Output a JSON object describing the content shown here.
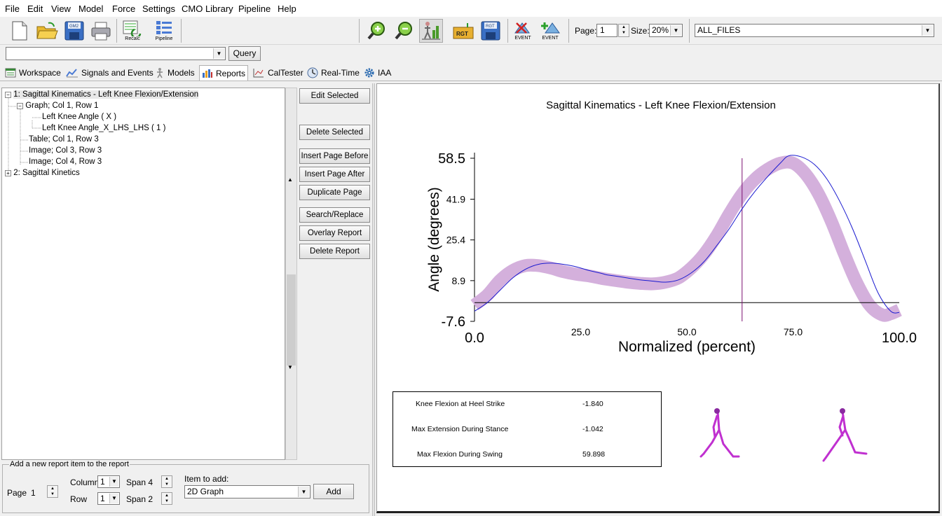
{
  "menu": [
    "File",
    "Edit",
    "View",
    "Model",
    "Force",
    "Settings",
    "CMO Library",
    "Pipeline",
    "Help"
  ],
  "toolbar": {
    "recalc_label": "Recalc",
    "pipeline_label": "Pipeline",
    "gm2_label": "GM2",
    "rgt_label": "RGT",
    "event_label_1": "EVENT",
    "event_label_2": "EVENT",
    "page_label": "Page:",
    "page_value": "1",
    "size_label": "Size:",
    "size_value": "20%",
    "files_value": "ALL_FILES"
  },
  "query": {
    "value": "",
    "button_label": "Query"
  },
  "tabs": [
    {
      "label": "Workspace",
      "icon": "workspace-icon"
    },
    {
      "label": "Signals and Events",
      "icon": "signals-icon"
    },
    {
      "label": "Models",
      "icon": "models-icon"
    },
    {
      "label": "Reports",
      "icon": "reports-icon",
      "active": true
    },
    {
      "label": "CalTester",
      "icon": "caltester-icon"
    },
    {
      "label": "Real-Time",
      "icon": "realtime-icon"
    },
    {
      "label": "IAA",
      "icon": "gear-icon"
    }
  ],
  "tree": [
    {
      "label": "1: Sagittal Kinematics - Left Knee Flexion/Extension",
      "level": 0,
      "expander": "−"
    },
    {
      "label": "Graph; Col 1, Row 1",
      "level": 1,
      "expander": "−"
    },
    {
      "label": "Left Knee Angle ( X )",
      "level": 2,
      "expander": ""
    },
    {
      "label": "Left Knee Angle_X_LHS_LHS ( 1 )",
      "level": 2,
      "expander": ""
    },
    {
      "label": "Table; Col 1, Row 3",
      "level": 1,
      "expander": ""
    },
    {
      "label": "Image; Col 3, Row 3",
      "level": 1,
      "expander": ""
    },
    {
      "label": "Image; Col 4, Row 3",
      "level": 1,
      "expander": ""
    },
    {
      "label": "2: Sagittal Kinetics",
      "level": 0,
      "expander": "+"
    }
  ],
  "side_buttons": [
    {
      "label": "Edit Selected",
      "name": "edit-selected-button"
    },
    {
      "label": "Delete Selected",
      "name": "delete-selected-button"
    },
    {
      "label": "Insert Page Before",
      "name": "insert-page-before-button"
    },
    {
      "label": "Insert Page After",
      "name": "insert-page-after-button"
    },
    {
      "label": "Duplicate Page",
      "name": "duplicate-page-button"
    },
    {
      "label": "Search/Replace",
      "name": "search-replace-button"
    },
    {
      "label": "Overlay Report",
      "name": "overlay-report-button"
    },
    {
      "label": "Delete Report",
      "name": "delete-report-button"
    }
  ],
  "add_item": {
    "legend": "Add a new report item to the report",
    "page_label": "Page",
    "page_value": "1",
    "column_label": "Column",
    "column_value": "1",
    "row_label": "Row",
    "row_value": "1",
    "span1_label": "Span 4",
    "span2_label": "Span 2",
    "item_label": "Item to add:",
    "item_value": "2D Graph",
    "add_button": "Add"
  },
  "report": {
    "stats": [
      {
        "label": "Knee Flexion at Heel Strike",
        "value": "-1.840"
      },
      {
        "label": "Max Extension During Stance",
        "value": "-1.042"
      },
      {
        "label": "Max Flexion During Swing",
        "value": "59.898"
      }
    ]
  },
  "chart_data": {
    "type": "line",
    "title": "Sagittal Kinematics - Left Knee Flexion/Extension",
    "xlabel": "Normalized (percent)",
    "ylabel": "Angle (degrees)",
    "xlim": [
      0,
      100
    ],
    "ylim": [
      -7.6,
      58.5
    ],
    "x_ticks": [
      "0.0",
      "25.0",
      "50.0",
      "75.0",
      "100.0"
    ],
    "y_ticks": [
      "58.5",
      "41.9",
      "25.4",
      "8.9",
      "-7.6"
    ],
    "reference_line_x": 63,
    "zero_line_y": 0,
    "series": [
      {
        "role": "normal-band",
        "color": "#d4b0dc",
        "band_width": 2.6,
        "x": [
          0,
          3,
          6,
          9,
          12,
          15,
          18,
          21,
          24,
          27,
          30,
          33,
          36,
          39,
          42,
          45,
          48,
          51,
          54,
          57,
          60,
          63,
          66,
          69,
          72,
          75,
          78,
          81,
          84,
          87,
          90,
          93,
          96,
          98,
          100
        ],
        "y": [
          -1,
          3,
          9,
          13,
          15,
          15,
          14,
          12.5,
          11.5,
          10.8,
          9.8,
          9,
          8.3,
          7.8,
          7.6,
          8.3,
          10,
          14,
          19.5,
          27,
          36,
          44,
          50,
          54,
          56.5,
          56.5,
          52,
          44,
          33,
          20,
          8,
          -1,
          -5,
          -4.5,
          -3
        ]
      },
      {
        "role": "subject",
        "color": "#1a1ad0",
        "x": [
          0,
          3,
          6,
          9,
          12,
          15,
          18,
          21,
          24,
          27,
          30,
          31,
          33,
          36,
          39,
          42,
          45,
          48,
          51,
          54,
          57,
          60,
          63,
          66,
          69,
          72,
          74,
          77,
          80,
          83,
          86,
          89,
          92,
          95,
          98,
          100
        ],
        "y": [
          -3.5,
          0,
          5,
          10,
          13.5,
          15.5,
          16,
          15.5,
          14.5,
          13,
          11.8,
          11.3,
          10.8,
          10,
          9.2,
          8.7,
          8.3,
          9.2,
          12,
          16.5,
          23,
          30,
          38,
          45,
          51,
          56.5,
          59.5,
          59,
          56,
          50,
          41,
          30,
          17,
          4,
          -3.5,
          -4
        ]
      }
    ]
  }
}
